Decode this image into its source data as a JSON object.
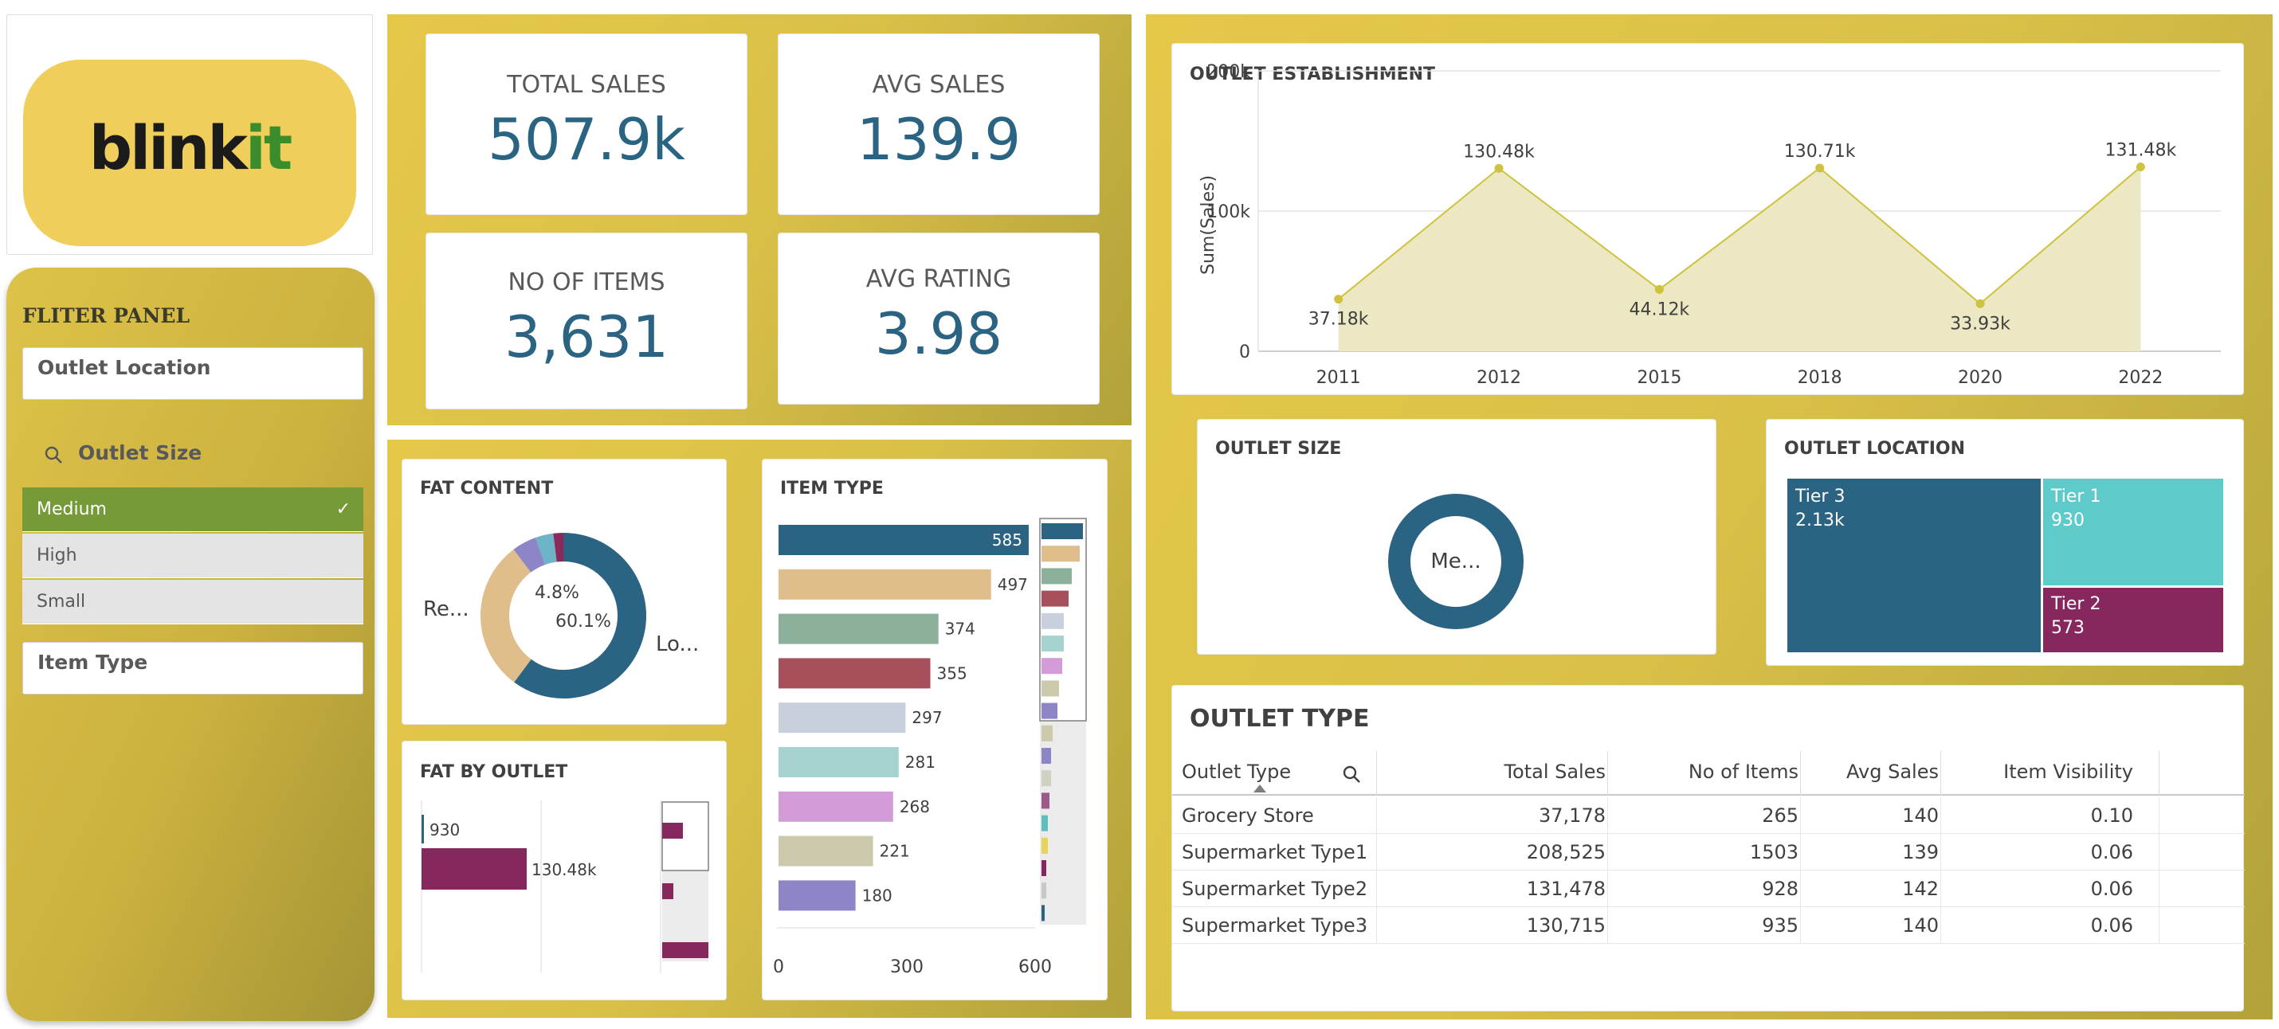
{
  "brand": {
    "logo_text": "blinkit",
    "logo_bg": "#f0ce5c"
  },
  "colors": {
    "accent": "#2a6482",
    "gold": "#d9c048",
    "selected": "#769a38"
  },
  "filter_panel": {
    "title": "FLITER PANEL",
    "outlet_location_label": "Outlet Location",
    "outlet_size_label": "Outlet Size",
    "outlet_size_options": [
      {
        "label": "Medium",
        "selected": true
      },
      {
        "label": "High",
        "selected": false
      },
      {
        "label": "Small",
        "selected": false
      }
    ],
    "item_type_label": "Item Type"
  },
  "kpis": [
    {
      "label": "TOTAL SALES",
      "value": "507.9k"
    },
    {
      "label": "AVG SALES",
      "value": "139.9"
    },
    {
      "label": "NO OF ITEMS",
      "value": "3,631"
    },
    {
      "label": "AVG RATING",
      "value": "3.98"
    }
  ],
  "fat_content": {
    "title": "FAT CONTENT",
    "labels": [
      "Re...",
      "Lo...",
      "4.8%",
      "60.1%"
    ]
  },
  "fat_by_outlet": {
    "title": "FAT BY OUTLET",
    "labels": [
      "930",
      "130.48k"
    ]
  },
  "item_type": {
    "title": "ITEM TYPE"
  },
  "outlet_establishment": {
    "title": "OUTLET ESTABLISHMENT"
  },
  "outlet_size": {
    "title": "OUTLET SIZE",
    "center_label": "Me..."
  },
  "outlet_location": {
    "title": "OUTLET LOCATION"
  },
  "outlet_type": {
    "title": "OUTLET TYPE",
    "columns": [
      "Outlet Type",
      "Total Sales",
      "No of Items",
      "Avg Sales",
      "Item Visibility"
    ],
    "rows": [
      [
        "Grocery Store",
        "37,178",
        "265",
        "140",
        "0.10"
      ],
      [
        "Supermarket Type1",
        "208,525",
        "1503",
        "139",
        "0.06"
      ],
      [
        "Supermarket Type2",
        "131,478",
        "928",
        "142",
        "0.06"
      ],
      [
        "Supermarket Type3",
        "130,715",
        "935",
        "140",
        "0.06"
      ]
    ]
  },
  "chart_data": [
    {
      "type": "area",
      "title": "OUTLET ESTABLISHMENT",
      "ylabel": "Sum(Sales)",
      "categories": [
        "2011",
        "2012",
        "2015",
        "2018",
        "2020",
        "2022"
      ],
      "values": [
        37180,
        130480,
        44120,
        130710,
        33930,
        131480
      ],
      "value_labels": [
        "37.18k",
        "130.48k",
        "44.12k",
        "130.71k",
        "33.93k",
        "131.48k"
      ],
      "y_ticks": [
        "0",
        "100k",
        "200k"
      ],
      "ylim": [
        0,
        200000
      ],
      "grid": true,
      "color": "#cfc23f"
    },
    {
      "type": "bar",
      "title": "ITEM TYPE",
      "orientation": "horizontal",
      "values": [
        585,
        497,
        374,
        355,
        297,
        281,
        268,
        221,
        180
      ],
      "colors": [
        "#2a6482",
        "#dfbe8c",
        "#8db09a",
        "#a5505a",
        "#c8d0de",
        "#a6d3cf",
        "#d49bd9",
        "#cdc9ad",
        "#8c86c7"
      ],
      "x_ticks": [
        "0",
        "300",
        "600"
      ],
      "xlim": [
        0,
        600
      ]
    },
    {
      "type": "pie",
      "title": "FAT CONTENT",
      "donut": true,
      "slices": [
        {
          "label": "Lo...",
          "value": 60.1,
          "color": "#2a6482"
        },
        {
          "label": "Re...",
          "value": 29.6,
          "color": "#dfbe8c"
        },
        {
          "label": "",
          "value": 4.8,
          "color": "#8c86c7"
        },
        {
          "label": "",
          "value": 3.5,
          "color": "#6eb4c8"
        },
        {
          "label": "",
          "value": 2.0,
          "color": "#8b2a5a"
        }
      ]
    },
    {
      "type": "pie",
      "title": "OUTLET SIZE",
      "donut": true,
      "slices": [
        {
          "label": "Me...",
          "value": 100,
          "color": "#2a6482"
        }
      ]
    },
    {
      "type": "heatmap",
      "title": "OUTLET LOCATION",
      "tiles": [
        {
          "label": "Tier 3",
          "value": "2.13k",
          "color": "#2a6482"
        },
        {
          "label": "Tier 1",
          "value": "930",
          "color": "#5fcaca"
        },
        {
          "label": "Tier 2",
          "value": "573",
          "color": "#86285e"
        }
      ]
    },
    {
      "type": "bar",
      "title": "FAT BY OUTLET",
      "orientation": "horizontal",
      "values": [
        930,
        130480
      ],
      "value_labels": [
        "930",
        "130.48k"
      ],
      "colors": [
        "#2a6482",
        "#86285e"
      ]
    }
  ]
}
